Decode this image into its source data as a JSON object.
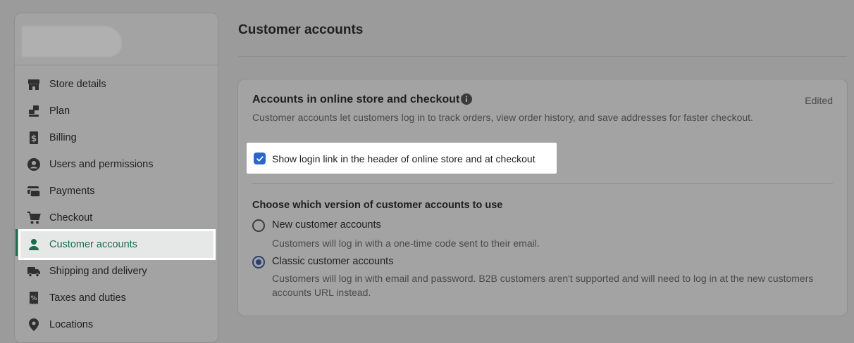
{
  "sidebar": {
    "items": [
      {
        "label": "Store details",
        "icon": "store-icon"
      },
      {
        "label": "Plan",
        "icon": "plan-icon"
      },
      {
        "label": "Billing",
        "icon": "billing-icon"
      },
      {
        "label": "Users and permissions",
        "icon": "user-circle-icon"
      },
      {
        "label": "Payments",
        "icon": "payments-icon"
      },
      {
        "label": "Checkout",
        "icon": "cart-icon"
      },
      {
        "label": "Customer accounts",
        "icon": "person-icon",
        "active": true
      },
      {
        "label": "Shipping and delivery",
        "icon": "truck-icon"
      },
      {
        "label": "Taxes and duties",
        "icon": "tax-receipt-icon"
      },
      {
        "label": "Locations",
        "icon": "location-pin-icon"
      }
    ]
  },
  "page": {
    "title": "Customer accounts"
  },
  "card": {
    "title": "Accounts in online store and checkout",
    "status": "Edited",
    "description": "Customer accounts let customers log in to track orders, view order history, and save addresses for faster checkout.",
    "login_link": {
      "label": "Show login link in the header of online store and at checkout",
      "checked": true
    },
    "version": {
      "heading": "Choose which version of customer accounts to use",
      "options": [
        {
          "label": "New customer accounts",
          "description": "Customers will log in with a one-time code sent to their email.",
          "selected": false
        },
        {
          "label": "Classic customer accounts",
          "description": "Customers will log in with email and password. B2B customers aren't supported and will need to log in at the new customers accounts URL instead.",
          "selected": true
        }
      ]
    }
  },
  "colors": {
    "accent_green": "#1b6b4d",
    "checkbox_blue": "#2b67c9",
    "overlay_gray": "#9b9b9b"
  }
}
